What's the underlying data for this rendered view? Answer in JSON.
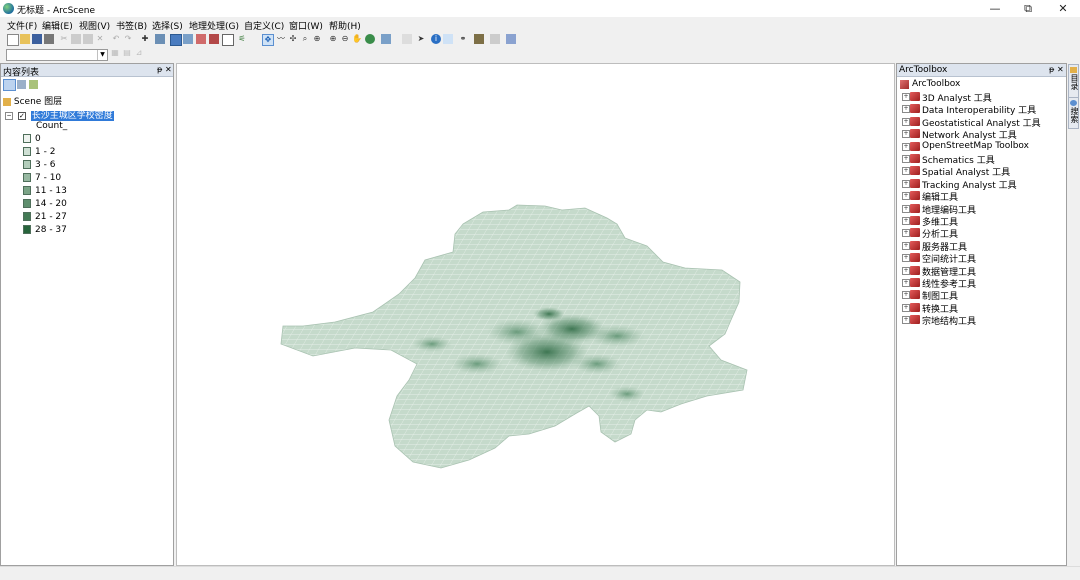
{
  "window": {
    "title": "无标题 - ArcScene",
    "min_glyph": "—",
    "max_glyph": "⧉",
    "close_glyph": "✕"
  },
  "menu": [
    "文件(F)",
    "编辑(E)",
    "视图(V)",
    "书签(B)",
    "选择(S)",
    "地理处理(G)",
    "自定义(C)",
    "窗口(W)",
    "帮助(H)"
  ],
  "toolbar_icons": {
    "row1": [
      "new-document-icon",
      "open-folder-icon",
      "save-icon",
      "print-icon",
      "cut-icon",
      "copy-icon",
      "paste-icon",
      "delete-icon",
      "undo-icon",
      "redo-icon",
      "add-data-icon",
      "layer-properties-icon",
      "full-screen-icon",
      "scene-properties-icon",
      "animation-icon",
      "camera-icon",
      "window-icon",
      "graph-icon",
      "navigate-icon",
      "fly-icon",
      "center-target-icon",
      "zoom-target-icon",
      "set-observer-icon",
      "zoom-in-icon",
      "zoom-out-icon",
      "pan-icon",
      "globe-icon",
      "full-extent-icon",
      "select-arrow-icon",
      "identify-icon",
      "html-popup-icon",
      "find-icon",
      "measure-icon",
      "3d-effects-icon",
      "toolbox-icon"
    ],
    "row2": [
      "layer-icon",
      "extrude-icon",
      "draw-icon"
    ]
  },
  "toc": {
    "title": "内容列表",
    "pin_glyph": "ᵽ",
    "close_glyph": "✕",
    "scene_label": "Scene 图层",
    "layer_name": "长沙主城区学校密度",
    "field_label": "Count_",
    "classes": [
      {
        "label": "0",
        "color": "#eef3ef"
      },
      {
        "label": "1 - 2",
        "color": "#cfe0d4"
      },
      {
        "label": "3 - 6",
        "color": "#b3cdbb"
      },
      {
        "label": "7 - 10",
        "color": "#97b8a1"
      },
      {
        "label": "11 - 13",
        "color": "#7ba487"
      },
      {
        "label": "14 - 20",
        "color": "#5f8f6e"
      },
      {
        "label": "21 - 27",
        "color": "#437a55"
      },
      {
        "label": "28 - 37",
        "color": "#27643c"
      }
    ]
  },
  "toolbox": {
    "title": "ArcToolbox",
    "root": "ArcToolbox",
    "pin_glyph": "ᵽ",
    "close_glyph": "✕",
    "items": [
      "3D Analyst 工具",
      "Data Interoperability 工具",
      "Geostatistical Analyst 工具",
      "Network Analyst 工具",
      "OpenStreetMap Toolbox",
      "Schematics 工具",
      "Spatial Analyst 工具",
      "Tracking Analyst 工具",
      "编辑工具",
      "地理编码工具",
      "多维工具",
      "分析工具",
      "服务器工具",
      "空间统计工具",
      "数据管理工具",
      "线性参考工具",
      "制图工具",
      "转换工具",
      "宗地结构工具"
    ]
  },
  "side_tabs": [
    "目录",
    "搜索"
  ],
  "map": {
    "grid_color": "#c8dacd",
    "hotspot_color": "#2f6b45"
  }
}
